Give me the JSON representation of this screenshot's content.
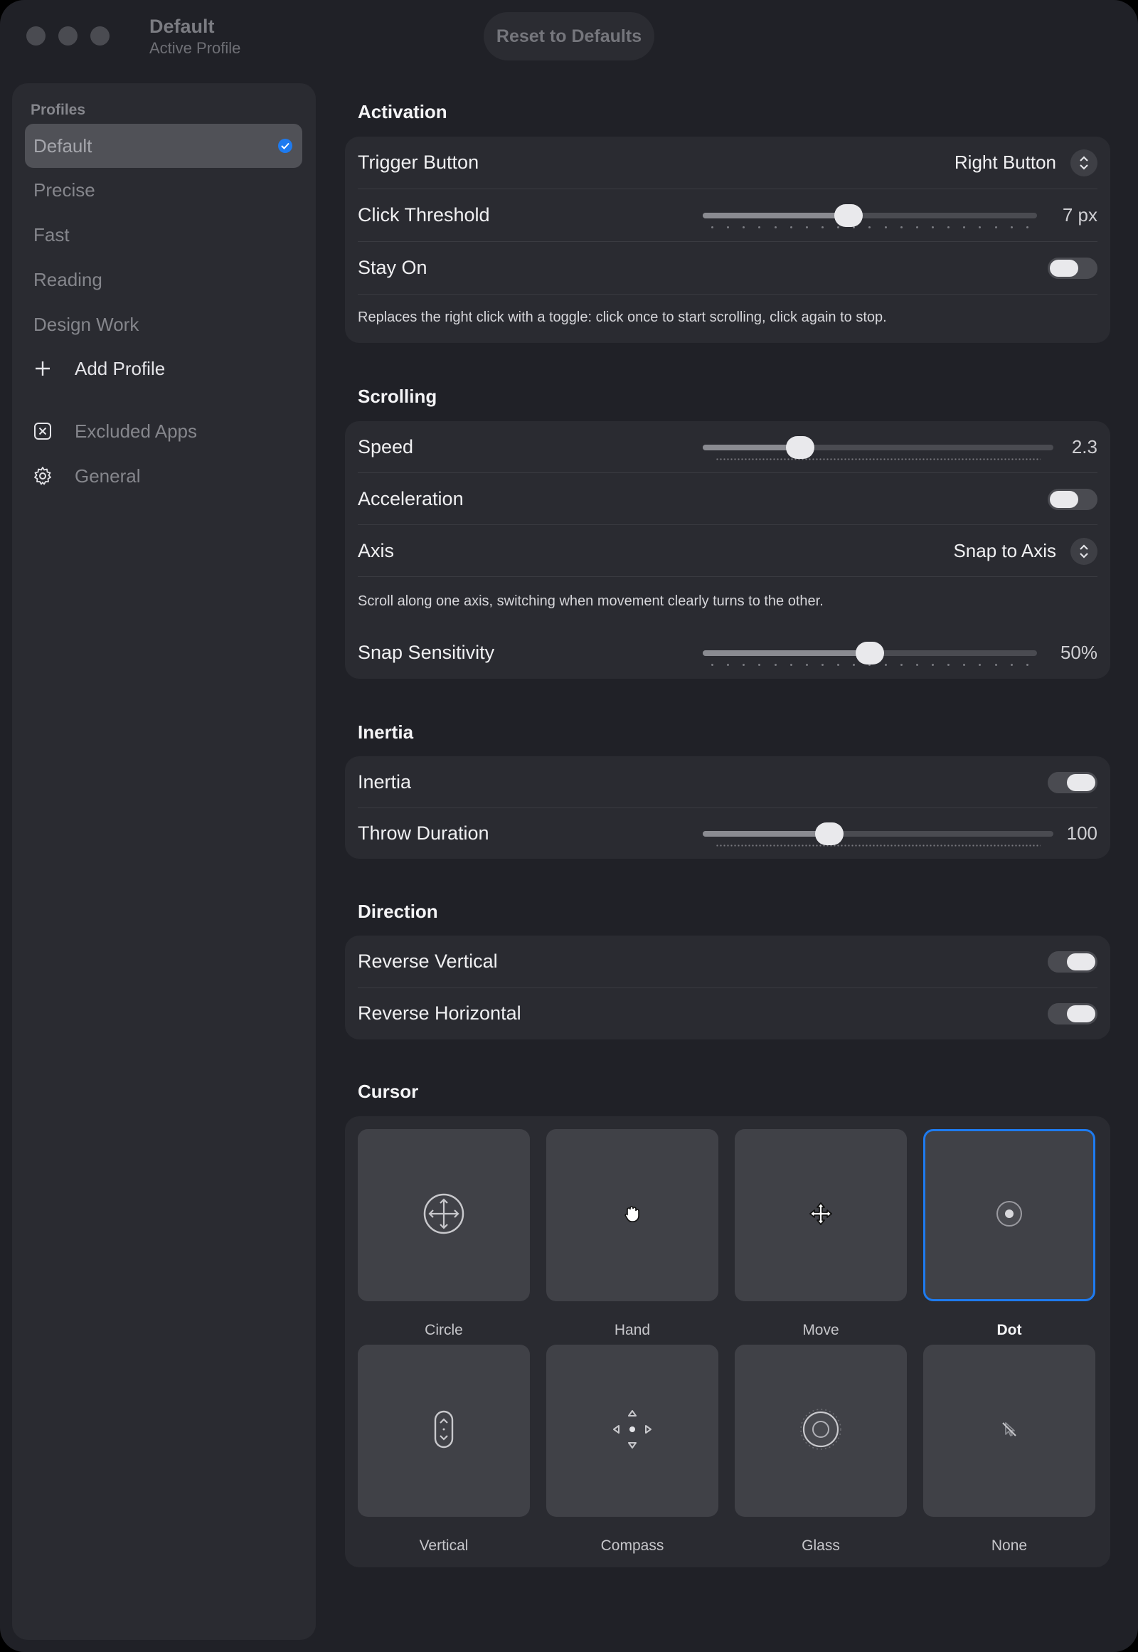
{
  "window": {
    "title": "Default",
    "subtitle": "Active Profile",
    "reset_label": "Reset to Defaults"
  },
  "sidebar": {
    "header": "Profiles",
    "profiles": [
      {
        "label": "Default",
        "selected": true
      },
      {
        "label": "Precise"
      },
      {
        "label": "Fast"
      },
      {
        "label": "Reading"
      },
      {
        "label": "Design Work"
      }
    ],
    "add_profile": "Add Profile",
    "excluded_apps": "Excluded Apps",
    "general": "General"
  },
  "activation": {
    "title": "Activation",
    "trigger_label": "Trigger Button",
    "trigger_value": "Right Button",
    "threshold_label": "Click Threshold",
    "threshold_value": "7 px",
    "threshold_fraction": 0.43,
    "stay_on_label": "Stay On",
    "stay_on": false,
    "description": "Replaces the right click with a toggle: click once to start scrolling, click again to stop."
  },
  "scrolling": {
    "title": "Scrolling",
    "speed_label": "Speed",
    "speed_value": "2.3",
    "speed_fraction": 0.26,
    "acceleration_label": "Acceleration",
    "acceleration": false,
    "axis_label": "Axis",
    "axis_value": "Snap to Axis",
    "axis_description": "Scroll along one axis, switching when movement clearly turns to the other.",
    "snap_label": "Snap Sensitivity",
    "snap_value": "50%",
    "snap_fraction": 0.5
  },
  "inertia": {
    "title": "Inertia",
    "inertia_label": "Inertia",
    "inertia": true,
    "throw_label": "Throw Duration",
    "throw_value": "100",
    "throw_fraction": 0.35
  },
  "direction": {
    "title": "Direction",
    "reverse_vertical_label": "Reverse Vertical",
    "reverse_vertical": true,
    "reverse_horizontal_label": "Reverse Horizontal",
    "reverse_horizontal": true
  },
  "cursor": {
    "title": "Cursor",
    "options": [
      {
        "label": "Circle",
        "icon": "circle-arrows-icon"
      },
      {
        "label": "Hand",
        "icon": "hand-icon"
      },
      {
        "label": "Move",
        "icon": "move-icon"
      },
      {
        "label": "Dot",
        "icon": "dot-icon",
        "selected": true
      },
      {
        "label": "Vertical",
        "icon": "vertical-icon"
      },
      {
        "label": "Compass",
        "icon": "compass-icon"
      },
      {
        "label": "Glass",
        "icon": "glass-icon"
      },
      {
        "label": "None",
        "icon": "none-icon"
      }
    ]
  },
  "colors": {
    "accent": "#1e7bf0",
    "window_bg": "#202127",
    "card_bg": "#2a2b31"
  }
}
